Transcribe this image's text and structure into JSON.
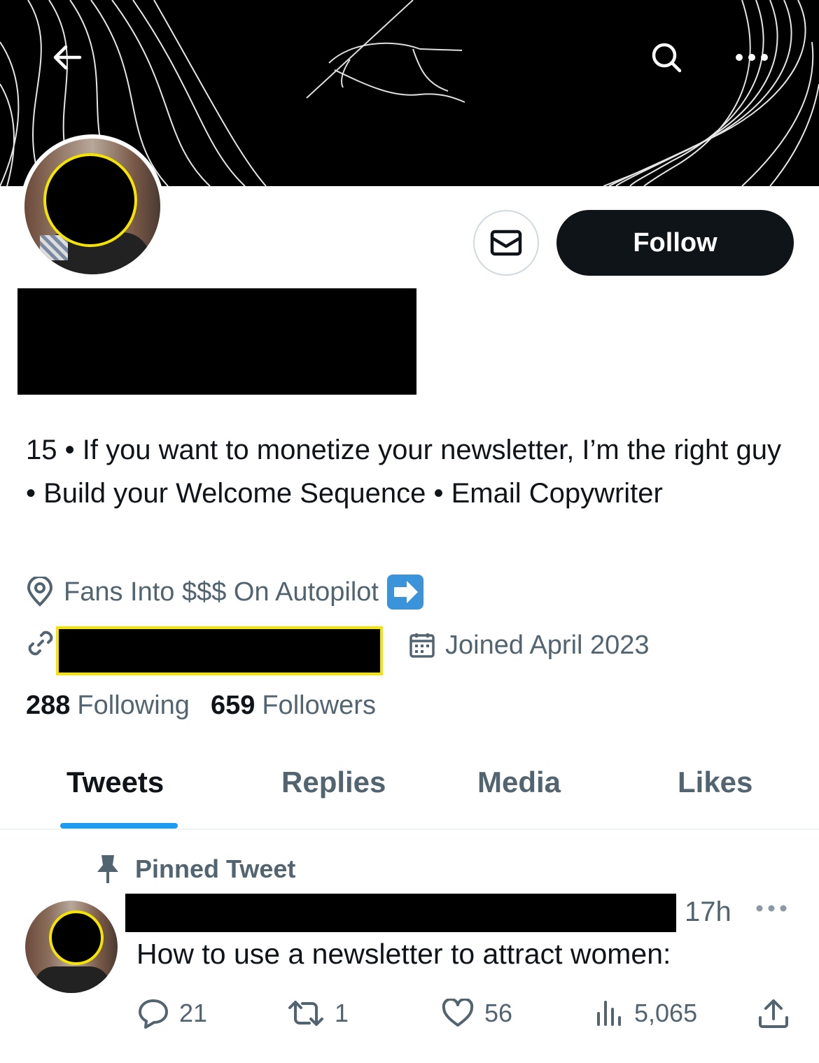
{
  "header": {
    "back_icon": "arrow-left-icon",
    "search_icon": "search-icon",
    "more_icon": "more-horizontal-icon"
  },
  "profile": {
    "follow_label": "Follow",
    "message_icon": "envelope-icon",
    "bio": "15 • If you want to monetize your newsletter, I’m the right guy • Build your Welcome Sequence • Email Copywriter",
    "location": "Fans Into $$$ On Autopilot",
    "joined": "Joined April 2023",
    "following_count": "288",
    "following_label": "Following",
    "followers_count": "659",
    "followers_label": "Followers"
  },
  "tabs": [
    "Tweets",
    "Replies",
    "Media",
    "Likes"
  ],
  "active_tab": "Tweets",
  "pinned_tweet": {
    "pinned_label": "Pinned Tweet",
    "time": "17h",
    "text": "How to use a newsletter to attract women:",
    "replies": "21",
    "retweets": "1",
    "likes": "56",
    "views": "5,065"
  },
  "colors": {
    "accent": "#1d9bf0",
    "text": "#0f1419",
    "secondary": "#536471",
    "redaction_outline": "#f5e400"
  }
}
